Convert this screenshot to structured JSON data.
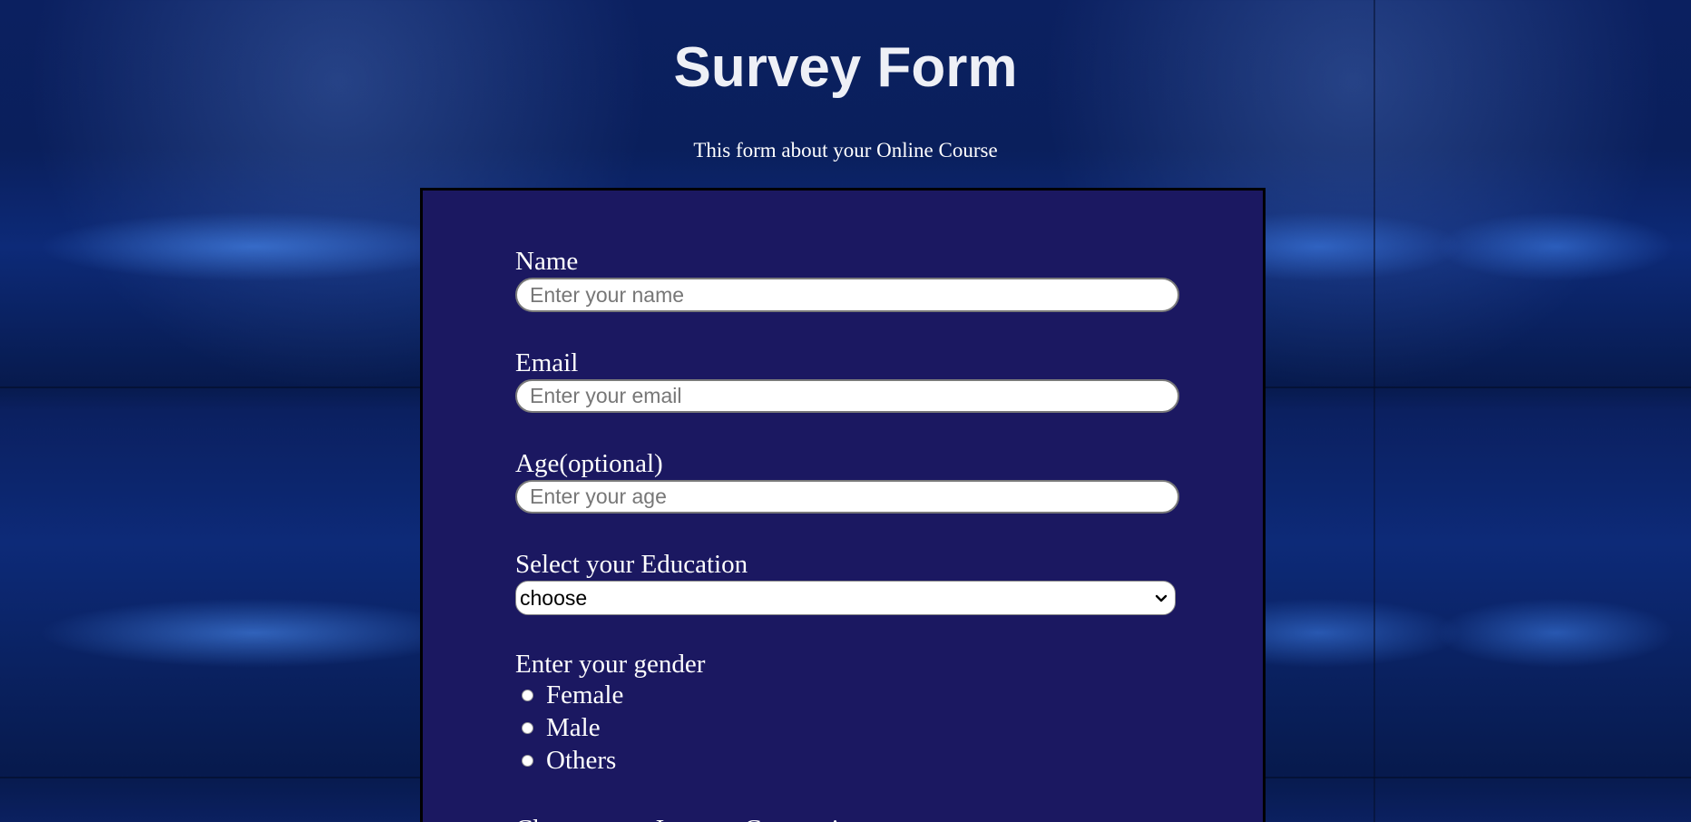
{
  "header": {
    "title": "Survey Form",
    "description": "This form about your Online Course"
  },
  "form": {
    "name": {
      "label": "Name",
      "placeholder": "Enter your name",
      "value": ""
    },
    "email": {
      "label": "Email",
      "placeholder": "Enter your email",
      "value": ""
    },
    "age": {
      "label": "Age(optional)",
      "placeholder": "Enter your age",
      "value": ""
    },
    "education": {
      "label": "Select your Education",
      "selected": "choose"
    },
    "gender": {
      "label": "Enter your gender",
      "options": [
        "Female",
        "Male",
        "Others"
      ]
    },
    "internet": {
      "label": "Choose your Internet Connection"
    }
  },
  "colors": {
    "panel": "#1b1861",
    "text": "#ffffff",
    "title": "#eef0f6"
  },
  "icons": {
    "select_arrow": "chevron-down-icon"
  }
}
